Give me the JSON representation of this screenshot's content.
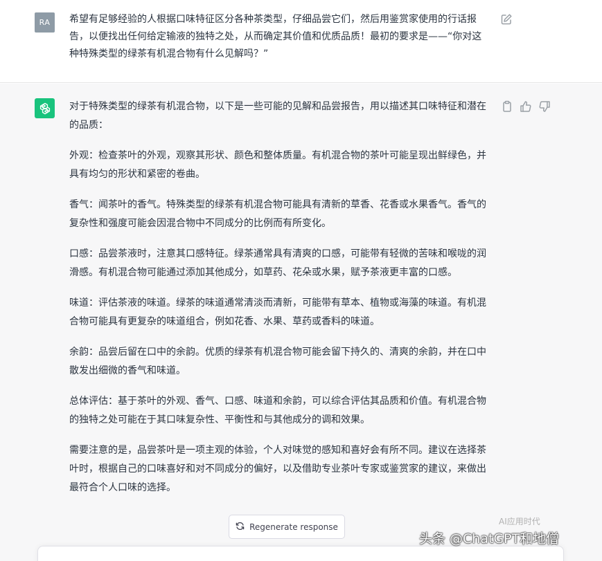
{
  "user_message": {
    "avatar_initials": "RA",
    "text": "希望有足够经验的人根据口味特征区分各种茶类型，仔细品尝它们，然后用鉴赏家使用的行话报告，以便找出任何给定输液的独特之处，从而确定其价值和优质品质！最初的要求是——“你对这种特殊类型的绿茶有机混合物有什么见解吗？”"
  },
  "assistant_message": {
    "paragraphs": [
      "对于特殊类型的绿茶有机混合物，以下是一些可能的见解和品尝报告，用以描述其口味特征和潜在的品质：",
      "外观：检查茶叶的外观，观察其形状、颜色和整体质量。有机混合物的茶叶可能呈现出鲜绿色，并具有均匀的形状和紧密的卷曲。",
      "香气：闻茶叶的香气。特殊类型的绿茶有机混合物可能具有清新的草香、花香或水果香气。香气的复杂性和强度可能会因混合物中不同成分的比例而有所变化。",
      "口感：品尝茶液时，注意其口感特征。绿茶通常具有清爽的口感，可能带有轻微的苦味和喉咙的润滑感。有机混合物可能通过添加其他成分，如草药、花朵或水果，赋予茶液更丰富的口感。",
      "味道：评估茶液的味道。绿茶的味道通常清淡而清新，可能带有草本、植物或海藻的味道。有机混合物可能具有更复杂的味道组合，例如花香、水果、草药或香料的味道。",
      "余韵：品尝后留在口中的余韵。优质的绿茶有机混合物可能会留下持久的、清爽的余韵，并在口中散发出细微的香气和味道。",
      "总体评估：基于茶叶的外观、香气、口感、味道和余韵，可以综合评估其品质和价值。有机混合物的独特之处可能在于其口味复杂性、平衡性和与其他成分的调和效果。",
      "需要注意的是，品尝茶叶是一项主观的体验，个人对味觉的感知和喜好会有所不同。建议在选择茶叶时，根据自己的口味喜好和对不同成分的偏好，以及借助专业茶叶专家或鉴赏家的建议，来做出最符合个人口味的选择。"
    ]
  },
  "controls": {
    "regenerate_label": "Regenerate response"
  },
  "watermark": {
    "text": "头条 @ChatGPT和地僧",
    "bubble": "AI应用时代"
  },
  "colors": {
    "user_avatar": "#8e9ba6",
    "assistant_avatar": "#19c37d",
    "assistant_bg": "#f7f7f8",
    "text": "#2b3440"
  },
  "icons": {
    "edit": "edit-icon",
    "copy": "clipboard-icon",
    "thumbs_up": "thumbs-up-icon",
    "thumbs_down": "thumbs-down-icon",
    "regenerate": "refresh-icon",
    "gpt_logo": "openai-logo-icon"
  }
}
